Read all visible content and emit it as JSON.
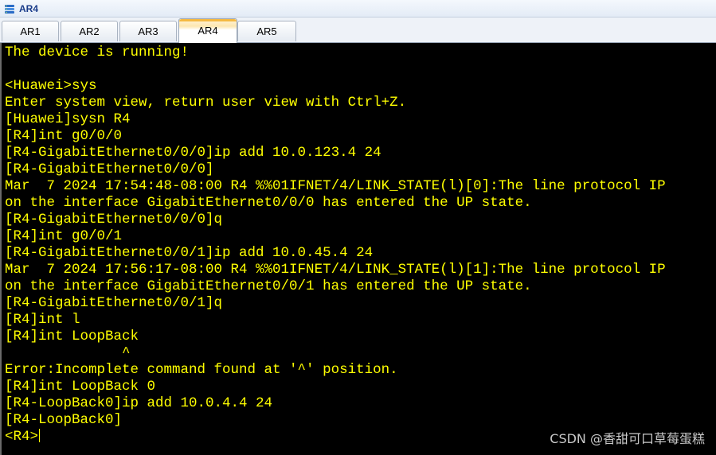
{
  "window": {
    "title": "AR4",
    "icon": "router-app-icon"
  },
  "tabs": [
    {
      "label": "AR1",
      "active": false
    },
    {
      "label": "AR2",
      "active": false
    },
    {
      "label": "AR3",
      "active": false
    },
    {
      "label": "AR4",
      "active": true
    },
    {
      "label": "AR5",
      "active": false
    }
  ],
  "terminal": {
    "text_color": "#ffff00",
    "background": "#000000",
    "lines": [
      "The device is running!",
      "",
      "<Huawei>sys",
      "Enter system view, return user view with Ctrl+Z.",
      "[Huawei]sysn R4",
      "[R4]int g0/0/0",
      "[R4-GigabitEthernet0/0/0]ip add 10.0.123.4 24",
      "[R4-GigabitEthernet0/0/0]",
      "Mar  7 2024 17:54:48-08:00 R4 %%01IFNET/4/LINK_STATE(l)[0]:The line protocol IP",
      "on the interface GigabitEthernet0/0/0 has entered the UP state.",
      "[R4-GigabitEthernet0/0/0]q",
      "[R4]int g0/0/1",
      "[R4-GigabitEthernet0/0/1]ip add 10.0.45.4 24",
      "Mar  7 2024 17:56:17-08:00 R4 %%01IFNET/4/LINK_STATE(l)[1]:The line protocol IP",
      "on the interface GigabitEthernet0/0/1 has entered the UP state.",
      "[R4-GigabitEthernet0/0/1]q",
      "[R4]int l",
      "[R4]int LoopBack",
      "              ^",
      "Error:Incomplete command found at '^' position.",
      "[R4]int LoopBack 0",
      "[R4-LoopBack0]ip add 10.0.4.4 24",
      "[R4-LoopBack0]",
      "<R4>"
    ]
  },
  "watermark": "CSDN @香甜可口草莓蛋糕"
}
